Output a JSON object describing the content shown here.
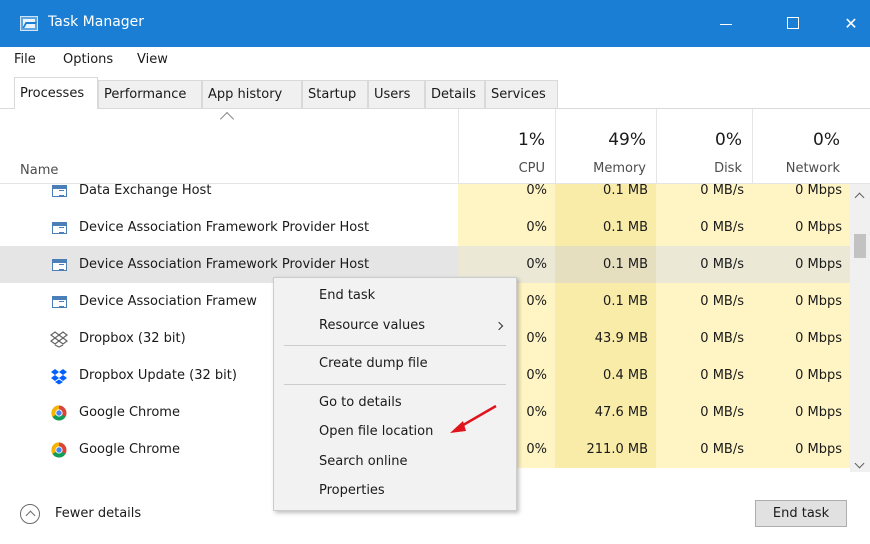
{
  "window": {
    "title": "Task Manager"
  },
  "menubar": {
    "file": "File",
    "options": "Options",
    "view": "View"
  },
  "tabs": [
    {
      "label": "Processes",
      "active": true
    },
    {
      "label": "Performance"
    },
    {
      "label": "App history"
    },
    {
      "label": "Startup"
    },
    {
      "label": "Users"
    },
    {
      "label": "Details"
    },
    {
      "label": "Services"
    }
  ],
  "columns": {
    "name": "Name",
    "cpu": {
      "pct": "1%",
      "label": "CPU"
    },
    "memory": {
      "pct": "49%",
      "label": "Memory"
    },
    "disk": {
      "pct": "0%",
      "label": "Disk"
    },
    "network": {
      "pct": "0%",
      "label": "Network"
    }
  },
  "rows": [
    {
      "name": "Data Exchange Host",
      "icon": "app-window-icon",
      "cpu": "0%",
      "memory": "0.1 MB",
      "disk": "0 MB/s",
      "network": "0 Mbps"
    },
    {
      "name": "Device Association Framework Provider Host",
      "icon": "app-window-icon",
      "cpu": "0%",
      "memory": "0.1 MB",
      "disk": "0 MB/s",
      "network": "0 Mbps"
    },
    {
      "name": "Device Association Framework Provider Host",
      "icon": "app-window-icon",
      "cpu": "0%",
      "memory": "0.1 MB",
      "disk": "0 MB/s",
      "network": "0 Mbps",
      "selected": true
    },
    {
      "name": "Device Association Framew",
      "icon": "app-window-icon",
      "cpu": "0%",
      "memory": "0.1 MB",
      "disk": "0 MB/s",
      "network": "0 Mbps"
    },
    {
      "name": "Dropbox (32 bit)",
      "icon": "dropbox-outline-icon",
      "cpu": "0%",
      "memory": "43.9 MB",
      "disk": "0 MB/s",
      "network": "0 Mbps"
    },
    {
      "name": "Dropbox Update (32 bit)",
      "icon": "dropbox-icon",
      "cpu": "0%",
      "memory": "0.4 MB",
      "disk": "0 MB/s",
      "network": "0 Mbps"
    },
    {
      "name": "Google Chrome",
      "icon": "chrome-icon",
      "cpu": "0%",
      "memory": "47.6 MB",
      "disk": "0 MB/s",
      "network": "0 Mbps"
    },
    {
      "name": "Google Chrome",
      "icon": "chrome-icon",
      "cpu": "0%",
      "memory": "211.0 MB",
      "disk": "0 MB/s",
      "network": "0 Mbps"
    }
  ],
  "context_menu": {
    "end_task": "End task",
    "resource_values": "Resource values",
    "create_dump_file": "Create dump file",
    "go_to_details": "Go to details",
    "open_file_location": "Open file location",
    "search_online": "Search online",
    "properties": "Properties"
  },
  "footer": {
    "fewer_details": "Fewer details",
    "end_task": "End task"
  },
  "colors": {
    "titlebar": "#1a7fd4",
    "heat_light": "#fff4c4",
    "heat_dark": "#f9eca8",
    "callout_arrow": "#e0141e"
  }
}
